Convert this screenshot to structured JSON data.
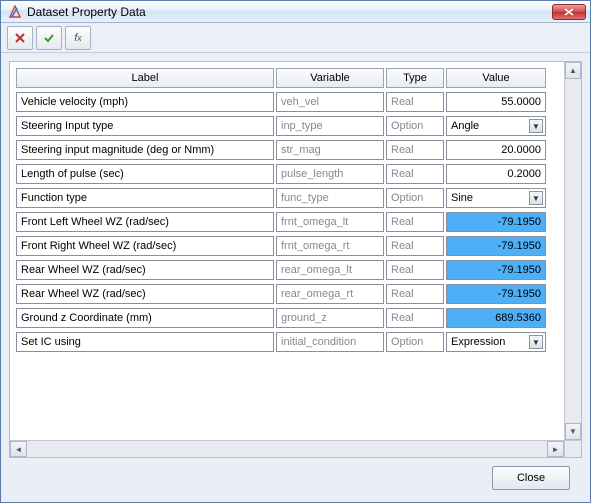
{
  "window": {
    "title": "Dataset Property Data"
  },
  "toolbar": {
    "cancel_icon": "x",
    "accept_icon": "check",
    "fx_icon": "fx"
  },
  "grid": {
    "headers": {
      "label": "Label",
      "variable": "Variable",
      "type": "Type",
      "value": "Value"
    },
    "rows": [
      {
        "label": "Vehicle velocity (mph)",
        "variable": "veh_vel",
        "type": "Real",
        "value": "55.0000",
        "kind": "num",
        "hl": false
      },
      {
        "label": "Steering Input type",
        "variable": "inp_type",
        "type": "Option",
        "value": "Angle",
        "kind": "option"
      },
      {
        "label": "Steering input magnitude (deg or Nmm)",
        "variable": "str_mag",
        "type": "Real",
        "value": "20.0000",
        "kind": "num",
        "hl": false
      },
      {
        "label": "Length of pulse (sec)",
        "variable": "pulse_length",
        "type": "Real",
        "value": "0.2000",
        "kind": "num",
        "hl": false
      },
      {
        "label": "Function type",
        "variable": "func_type",
        "type": "Option",
        "value": "Sine",
        "kind": "option"
      },
      {
        "label": "Front Left Wheel WZ (rad/sec)",
        "variable": "frnt_omega_lt",
        "type": "Real",
        "value": "-79.1950",
        "kind": "num",
        "hl": true
      },
      {
        "label": "Front Right Wheel WZ (rad/sec)",
        "variable": "frnt_omega_rt",
        "type": "Real",
        "value": "-79.1950",
        "kind": "num",
        "hl": true
      },
      {
        "label": "Rear Wheel WZ (rad/sec)",
        "variable": "rear_omega_lt",
        "type": "Real",
        "value": "-79.1950",
        "kind": "num",
        "hl": true
      },
      {
        "label": "Rear Wheel WZ (rad/sec)",
        "variable": "rear_omega_rt",
        "type": "Real",
        "value": "-79.1950",
        "kind": "num",
        "hl": true
      },
      {
        "label": "Ground z Coordinate (mm)",
        "variable": "ground_z",
        "type": "Real",
        "value": "689.5360",
        "kind": "num",
        "hl": true
      },
      {
        "label": "Set IC using",
        "variable": "initial_condition",
        "type": "Option",
        "value": "Expression",
        "kind": "option"
      }
    ]
  },
  "footer": {
    "close_label": "Close"
  }
}
